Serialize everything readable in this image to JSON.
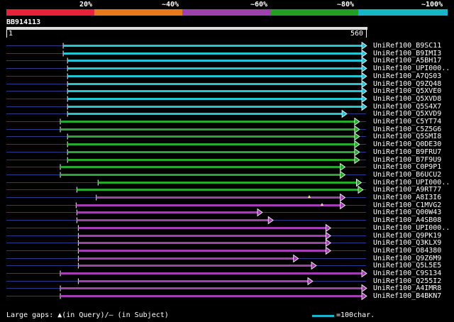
{
  "identity_scale": {
    "labels": [
      "20%",
      "~40%",
      "~60%",
      "~80%",
      "~100%"
    ],
    "colors": [
      "#e8223a",
      "#e87a1c",
      "#a040b0",
      "#20a020",
      "#18b4c8"
    ]
  },
  "query": {
    "id": "BB914113",
    "start": "1",
    "end": "560"
  },
  "colors": {
    "cyan": "#22c4d6",
    "green": "#28a828",
    "purple": "#a040b0",
    "query_line": "#2a3a8a",
    "gap_marker": "#e8e8a0"
  },
  "hits": [
    {
      "name": "UniRef100_B9SC11",
      "color": "cyan",
      "start": 0.158,
      "end": 1.0
    },
    {
      "name": "UniRef100_B9IMI3",
      "color": "cyan",
      "start": 0.158,
      "end": 1.0
    },
    {
      "name": "UniRef100_A5BH17",
      "color": "cyan",
      "start": 0.17,
      "end": 1.0
    },
    {
      "name": "UniRef100_UPI000..",
      "color": "cyan",
      "start": 0.17,
      "end": 1.0
    },
    {
      "name": "UniRef100_A7QS03",
      "color": "cyan",
      "start": 0.17,
      "end": 1.0
    },
    {
      "name": "UniRef100_Q9ZQ48",
      "color": "cyan",
      "start": 0.17,
      "end": 1.0
    },
    {
      "name": "UniRef100_Q5XVE0",
      "color": "cyan",
      "start": 0.17,
      "end": 1.0
    },
    {
      "name": "UniRef100_Q5XVD8",
      "color": "cyan",
      "start": 0.17,
      "end": 1.0
    },
    {
      "name": "UniRef100_Q5S4X7",
      "color": "cyan",
      "start": 0.17,
      "end": 1.0
    },
    {
      "name": "UniRef100_Q5XVD9",
      "color": "cyan",
      "start": 0.17,
      "end": 0.945
    },
    {
      "name": "UniRef100_C5YT74",
      "color": "green",
      "start": 0.15,
      "end": 0.98
    },
    {
      "name": "UniRef100_C5Z5G6",
      "color": "green",
      "start": 0.15,
      "end": 0.98
    },
    {
      "name": "UniRef100_Q5SMI8",
      "color": "green",
      "start": 0.17,
      "end": 0.98
    },
    {
      "name": "UniRef100_Q0DE30",
      "color": "green",
      "start": 0.17,
      "end": 0.98
    },
    {
      "name": "UniRef100_B9FRU7",
      "color": "green",
      "start": 0.17,
      "end": 0.98
    },
    {
      "name": "UniRef100_B7F9U9",
      "color": "green",
      "start": 0.17,
      "end": 0.98
    },
    {
      "name": "UniRef100_C0P9P1",
      "color": "green",
      "start": 0.15,
      "end": 0.94
    },
    {
      "name": "UniRef100_B6UCU2",
      "color": "green",
      "start": 0.15,
      "end": 0.94
    },
    {
      "name": "UniRef100_UPI000..",
      "color": "green",
      "start": 0.255,
      "end": 0.985
    },
    {
      "name": "UniRef100_A9RT77",
      "color": "green",
      "start": 0.196,
      "end": 0.99
    },
    {
      "name": "UniRef100_A8I3I6",
      "color": "purple",
      "start": 0.25,
      "end": 0.94
    },
    {
      "name": "UniRef100_C1MVG2",
      "color": "purple",
      "start": 0.194,
      "end": 0.94
    },
    {
      "name": "UniRef100_Q00W43",
      "color": "purple",
      "start": 0.196,
      "end": 0.71
    },
    {
      "name": "UniRef100_A4SB08",
      "color": "purple",
      "start": 0.196,
      "end": 0.74
    },
    {
      "name": "UniRef100_UPI000..",
      "color": "purple",
      "start": 0.2,
      "end": 0.9
    },
    {
      "name": "UniRef100_Q9PK19",
      "color": "purple",
      "start": 0.2,
      "end": 0.9
    },
    {
      "name": "UniRef100_Q3KLX9",
      "color": "purple",
      "start": 0.2,
      "end": 0.9
    },
    {
      "name": "UniRef100_O84380",
      "color": "purple",
      "start": 0.2,
      "end": 0.9
    },
    {
      "name": "UniRef100_Q9Z6M9",
      "color": "purple",
      "start": 0.2,
      "end": 0.81
    },
    {
      "name": "UniRef100_Q5L5E5",
      "color": "purple",
      "start": 0.2,
      "end": 0.86
    },
    {
      "name": "UniRef100_C9S134",
      "color": "purple",
      "start": 0.15,
      "end": 1.0
    },
    {
      "name": "UniRef100_Q255I2",
      "color": "purple",
      "start": 0.2,
      "end": 0.85
    },
    {
      "name": "UniRef100_A4IMR8",
      "color": "purple",
      "start": 0.15,
      "end": 1.0
    },
    {
      "name": "UniRef100_B4BKN7",
      "color": "purple",
      "start": 0.15,
      "end": 1.0
    }
  ],
  "legend": {
    "gaps_text": "Large gaps: ▲(in Query)/– (in Subject)",
    "scale_text": "=100char."
  }
}
